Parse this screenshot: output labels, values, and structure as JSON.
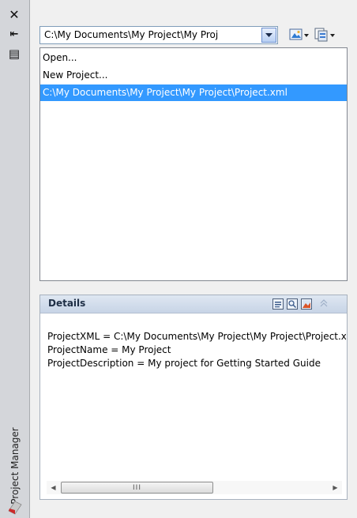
{
  "palette": {
    "title": "Project Manager",
    "close_glyph": "✕",
    "autohide_glyph": "⇤",
    "properties_glyph": "▤"
  },
  "project_combo": {
    "value": "C:\\My Documents\\My Project\\My Proj",
    "icon": "chevron-down-icon"
  },
  "toolbar": {
    "view_button_icon": "image-view-icon",
    "manage_button_icon": "project-pages-icon"
  },
  "dropdown": {
    "items": [
      {
        "label": "Open..."
      },
      {
        "label": "New Project..."
      },
      {
        "label": "C:\\My Documents\\My Project\\My Project\\Project.xml"
      }
    ],
    "selected_index": 2,
    "selection_color": "#3399ff"
  },
  "details": {
    "title": "Details",
    "lines": [
      "ProjectXML = C:\\My Documents\\My Project\\My Project\\Project.xml",
      "ProjectName = My Project",
      "ProjectDescription = My project for Getting Started Guide"
    ],
    "header_icons": [
      "details-view-icon",
      "preview-icon",
      "thumbnail-icon",
      "collapse-icon"
    ],
    "scroll_thumb_grip": "III"
  }
}
